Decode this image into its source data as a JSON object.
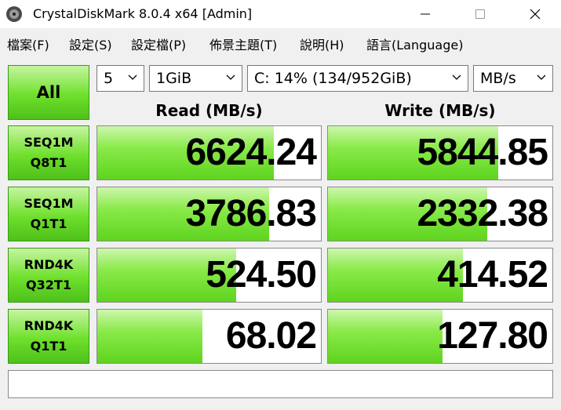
{
  "window": {
    "title": "CrystalDiskMark 8.0.4 x64 [Admin]"
  },
  "menu": {
    "items": [
      {
        "label": "檔案(F)"
      },
      {
        "label": "設定(S)"
      },
      {
        "label": "設定檔(P)"
      },
      {
        "label": "佈景主題(T)"
      },
      {
        "label": "說明(H)"
      },
      {
        "label": "語言(Language)"
      }
    ]
  },
  "controls": {
    "all_label": "All",
    "count": "5",
    "size": "1GiB",
    "drive": "C: 14% (134/952GiB)",
    "unit": "MB/s"
  },
  "headers": {
    "read": "Read (MB/s)",
    "write": "Write (MB/s)"
  },
  "tests": [
    {
      "line1": "SEQ1M",
      "line2": "Q8T1",
      "read": "6624.24",
      "write": "5844.85",
      "read_fill": 0.79,
      "write_fill": 0.76
    },
    {
      "line1": "SEQ1M",
      "line2": "Q1T1",
      "read": "3786.83",
      "write": "2332.38",
      "read_fill": 0.77,
      "write_fill": 0.71
    },
    {
      "line1": "RND4K",
      "line2": "Q32T1",
      "read": "524.50",
      "write": "414.52",
      "read_fill": 0.62,
      "write_fill": 0.6
    },
    {
      "line1": "RND4K",
      "line2": "Q1T1",
      "read": "68.02",
      "write": "127.80",
      "read_fill": 0.47,
      "write_fill": 0.51
    }
  ],
  "status": {
    "text": ""
  },
  "colors": {
    "bar_green": "#5ed41e",
    "button_green": "#6ee02c"
  }
}
